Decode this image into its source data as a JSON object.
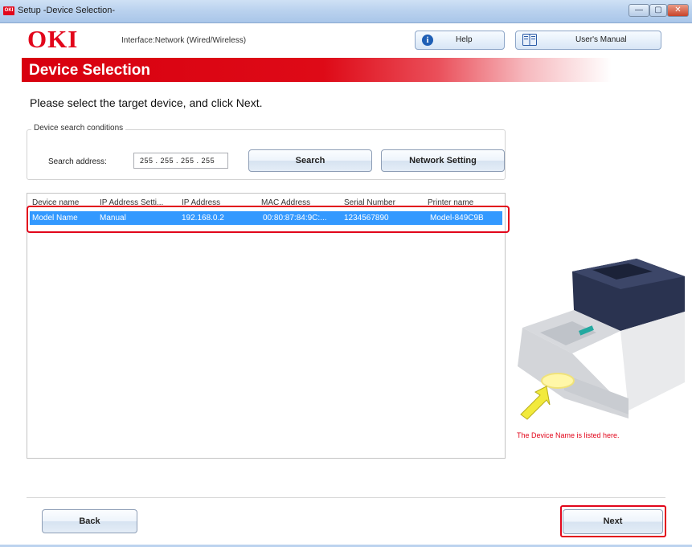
{
  "window": {
    "title": "Setup -Device Selection-",
    "app_icon_text": "OKI",
    "minimize_glyph": "—",
    "maximize_glyph": "▢",
    "close_glyph": "✕"
  },
  "header": {
    "logo": "OKI",
    "interface_text": "Interface:Network (Wired/Wireless)",
    "help_label": "Help",
    "manual_label": "User's Manual",
    "help_icon_glyph": "i",
    "icons": [
      "info-icon",
      "book-icon"
    ]
  },
  "banner": {
    "title": "Device Selection"
  },
  "instruction": "Please select the target device, and click Next.",
  "search": {
    "group_label": "Device search conditions",
    "address_label": "Search address:",
    "address_value": "255 . 255 . 255 . 255",
    "search_label": "Search",
    "network_setting_label": "Network Setting"
  },
  "device_list": {
    "columns": [
      "Device name",
      "IP Address Setti...",
      "IP Address",
      "MAC Address",
      "Serial Number",
      "Printer name"
    ],
    "rows": [
      {
        "device_name": "Model Name",
        "ip_setting": "Manual",
        "ip_address": "192.168.0.2",
        "mac_address": "00:80:87:84:9C:...",
        "serial_number": "1234567890",
        "printer_name": "Model-849C9B"
      }
    ]
  },
  "printer_caption": "The Device Name is listed here.",
  "footer": {
    "back_label": "Back",
    "next_label": "Next"
  },
  "colors": {
    "brand_red": "#e2061b",
    "selection_blue": "#3399ff",
    "titlebar": "#b9d1ee"
  }
}
